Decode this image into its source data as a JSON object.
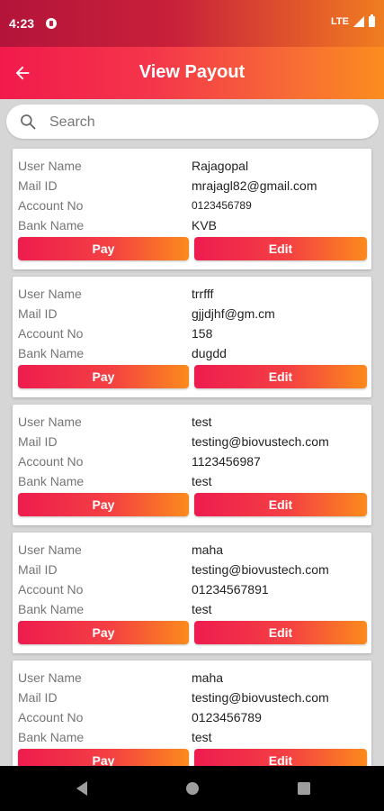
{
  "status_bar": {
    "time": "4:23",
    "network": "LTE"
  },
  "app_bar": {
    "title": "View Payout"
  },
  "search": {
    "placeholder": "Search"
  },
  "labels": {
    "user_name": "User Name",
    "mail_id": "Mail ID",
    "account_no": "Account No",
    "bank_name": "Bank Name",
    "pay": "Pay",
    "edit": "Edit"
  },
  "payouts": [
    {
      "user_name": "Rajagopal",
      "mail_id": "mrajagl82@gmail.com",
      "account_no": "0123456789",
      "bank_name": "KVB"
    },
    {
      "user_name": "trrfff",
      "mail_id": "gjjdjhf@gm.cm",
      "account_no": "158",
      "bank_name": "dugdd"
    },
    {
      "user_name": "test",
      "mail_id": "testing@biovustech.com",
      "account_no": "1123456987",
      "bank_name": "test"
    },
    {
      "user_name": "maha",
      "mail_id": "testing@biovustech.com",
      "account_no": "01234567891",
      "bank_name": "test"
    },
    {
      "user_name": "maha",
      "mail_id": "testing@biovustech.com",
      "account_no": "0123456789",
      "bank_name": "test"
    }
  ],
  "colors": {
    "accent_start": "#f21a4c",
    "accent_end": "#fb8d1e"
  }
}
